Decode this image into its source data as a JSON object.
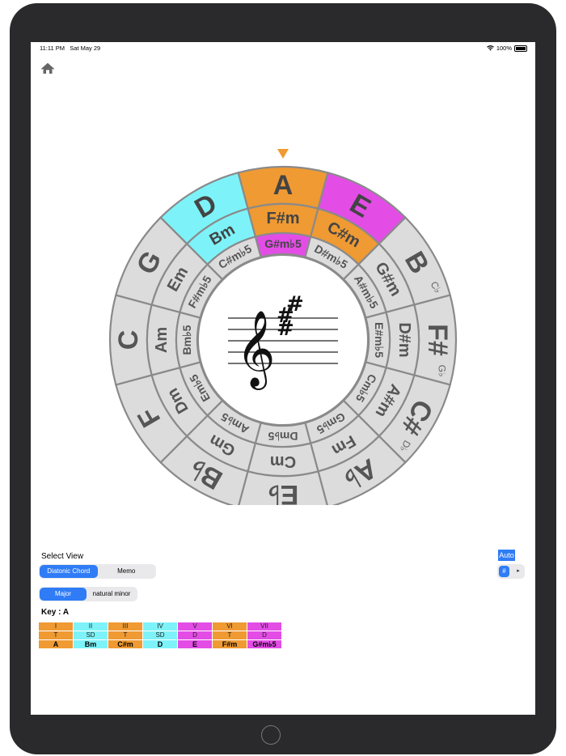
{
  "status_bar": {
    "time": "11:11 PM",
    "date": "Sat May 29",
    "battery": "100%"
  },
  "home_icon": "home-icon",
  "wheel": {
    "outer": [
      "A",
      "E",
      "B",
      "F#",
      "C#",
      "A♭",
      "E♭",
      "B♭",
      "F",
      "C",
      "G",
      "D"
    ],
    "outer_small": [
      "",
      "",
      "C♭",
      "G♭",
      "D♭",
      "",
      "",
      "",
      "",
      "",
      "",
      ""
    ],
    "middle": [
      "F#m",
      "C#m",
      "G#m",
      "D#m",
      "A#m",
      "Fm",
      "Cm",
      "Gm",
      "Dm",
      "Am",
      "Em",
      "Bm"
    ],
    "middle_small": [
      "",
      "",
      "",
      "",
      "",
      "",
      "",
      "",
      "",
      "",
      "",
      ""
    ],
    "inner": [
      "G#m♭5",
      "D#m♭5",
      "A#m♭5",
      "E#m♭5",
      "Cm♭5",
      "Gm♭5",
      "Dm♭5",
      "Am♭5",
      "Em♭5",
      "Bm♭5",
      "F#m♭5",
      "C#m♭5"
    ],
    "pointer_color": "#ef9a33",
    "colors": {
      "tonic": "#ef9a33",
      "subdominant": "#7df3f9",
      "dominant": "#e34de6",
      "neutral": "#dcdcdc"
    }
  },
  "controls": {
    "select_view_label": "Select View",
    "view_options": [
      "Diatonic Chord",
      "Memo"
    ],
    "mode_options": [
      "Major",
      "natural minor"
    ],
    "key_label": "Key : A",
    "auto_label": "Auto",
    "sharp_label": "#",
    "flat_label": "♭"
  },
  "diatonic": {
    "degrees": [
      "I",
      "II",
      "III",
      "IV",
      "V",
      "VI",
      "VII"
    ],
    "functions": [
      "T",
      "SD",
      "T",
      "SD",
      "D",
      "T",
      "D"
    ],
    "chords": [
      "A",
      "Bm",
      "C#m",
      "D",
      "E",
      "F#m",
      "G#m♭5"
    ],
    "colors": [
      "#ef9a33",
      "#7df3f9",
      "#ef9a33",
      "#7df3f9",
      "#e34de6",
      "#ef9a33",
      "#e34de6"
    ]
  }
}
